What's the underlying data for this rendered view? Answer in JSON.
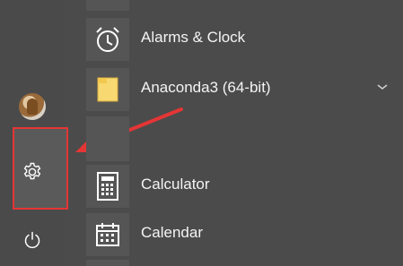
{
  "start_menu": {
    "apps": [
      {
        "label": "Alarms & Clock",
        "icon": "alarm-clock-icon"
      },
      {
        "label": "Anaconda3 (64-bit)",
        "icon": "folder-icon",
        "expandable": true
      },
      {
        "label": "Calculator",
        "icon": "calculator-icon"
      },
      {
        "label": "Calendar",
        "icon": "calendar-icon"
      }
    ],
    "rail": {
      "items": [
        "user-avatar",
        "settings-icon",
        "power-icon"
      ]
    }
  },
  "annotation": {
    "color": "#e53535"
  }
}
